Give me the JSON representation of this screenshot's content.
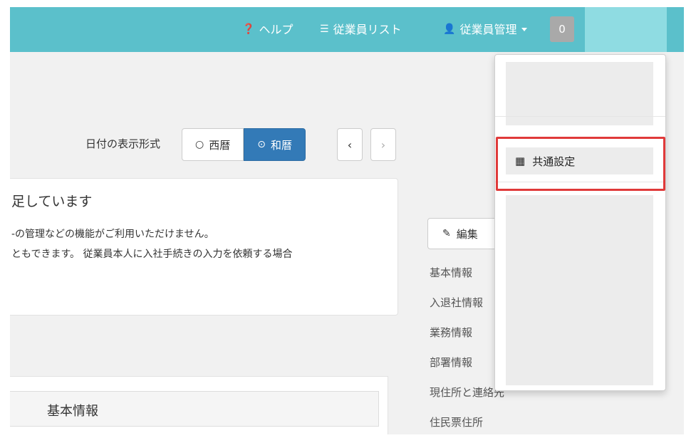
{
  "nav": {
    "help_label": "ヘルプ",
    "employee_list_label": "従業員リスト",
    "employee_mgmt_label": "従業員管理",
    "notification_count": "0",
    "help_icon": "question-circle-icon",
    "list_icon": "list-icon",
    "user_icon": "user-icon"
  },
  "date_format": {
    "label": "日付の表示形式",
    "options": [
      "西暦",
      "和暦"
    ],
    "selected": "和暦",
    "prev_label": "‹",
    "next_label": "›"
  },
  "notice": {
    "title": "足しています",
    "line1": "-の管理などの機能がご利用いただけません。",
    "line2": "ともできます。 従業員本人に入社手続きの入力を依頼する場合"
  },
  "panel": {
    "title": "基本情報"
  },
  "side": {
    "edit_label": "編集",
    "items": [
      "基本情報",
      "入退社情報",
      "業務情報",
      "部署情報",
      "現住所と連絡先",
      "住民票住所"
    ]
  },
  "dropdown": {
    "common_settings_label": "共通設定",
    "common_settings_icon": "building-icon"
  },
  "colors": {
    "topbar": "#5bc0cb",
    "primary": "#337ab7",
    "highlight": "#e03a3a",
    "badge": "#a9a9a9"
  }
}
